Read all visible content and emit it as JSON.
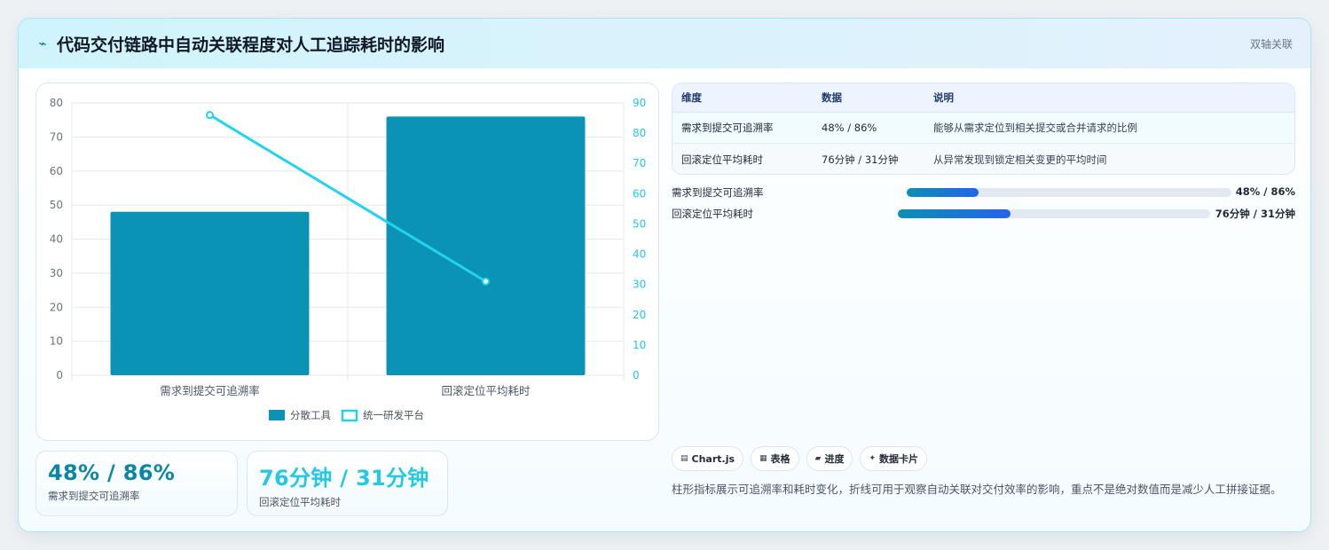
{
  "header": {
    "title": "代码交付链路中自动关联程度对人工追踪耗时的影响",
    "icon": "lightning-icon",
    "tag": "双轴关联"
  },
  "chart_data": {
    "type": "bar",
    "categories": [
      "需求到提交可追溯率",
      "回滚定位平均耗时"
    ],
    "series": [
      {
        "name": "分散工具",
        "type": "bar",
        "axis": "left",
        "color": "#0b93b5",
        "values": [
          48,
          76
        ]
      },
      {
        "name": "统一研发平台",
        "type": "line",
        "axis": "right",
        "color": "#22d3ee",
        "values": [
          86,
          31
        ]
      }
    ],
    "ylim_left": [
      0,
      80
    ],
    "ylim_right": [
      0,
      90
    ],
    "yticks_left": [
      "0",
      "10",
      "20",
      "30",
      "40",
      "50",
      "60",
      "70",
      "80"
    ],
    "yticks_right": [
      "0",
      "10",
      "20",
      "30",
      "40",
      "50",
      "60",
      "70",
      "80",
      "90"
    ],
    "grid": true,
    "legend_position": "bottom"
  },
  "kpis": [
    {
      "value": "48% / 86%",
      "label": "需求到提交可追溯率",
      "color": "#0b85a8"
    },
    {
      "value": "76分钟 / 31分钟",
      "label": "回滚定位平均耗时",
      "color": "#22c9e0"
    }
  ],
  "table": {
    "headers": [
      "维度",
      "数据",
      "说明"
    ],
    "rows": [
      [
        "需求到提交可追溯率",
        "48% / 86%",
        "能够从需求定位到相关提交或合并请求的比例"
      ],
      [
        "回滚定位平均耗时",
        "76分钟 / 31分钟",
        "从异常发现到锁定相关变更的平均时间"
      ]
    ]
  },
  "progress": [
    {
      "label": "需求到提交可追溯率",
      "value": "48% / 86%",
      "fill": 0.22
    },
    {
      "label": "回滚定位平均耗时",
      "value": "76分钟 / 31分钟",
      "fill": 0.36
    }
  ],
  "badges": [
    {
      "label": "Chart.js",
      "icon": "chart-icon",
      "glyph": "▤"
    },
    {
      "label": "表格",
      "icon": "table-icon",
      "glyph": "▦"
    },
    {
      "label": "进度",
      "icon": "progress-icon",
      "glyph": "▰"
    },
    {
      "label": "数据卡片",
      "icon": "sparkle-icon",
      "glyph": "✦"
    }
  ],
  "note": "柱形指标展示可追溯率和耗时变化，折线可用于观察自动关联对交付效率的影响，重点不是绝对数值而是减少人工拼接证据。"
}
